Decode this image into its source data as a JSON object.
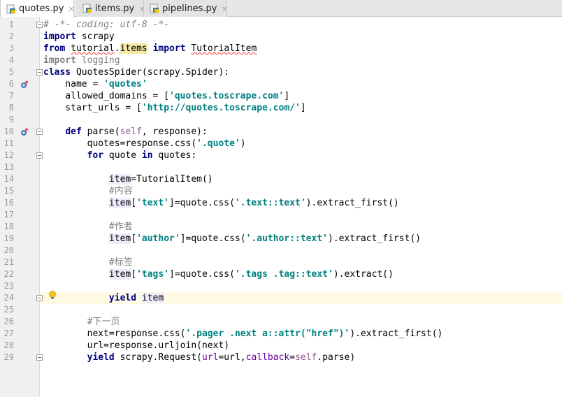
{
  "tabs": [
    {
      "label": "quotes.py",
      "active": true
    },
    {
      "label": "items.py",
      "active": false
    },
    {
      "label": "pipelines.py",
      "active": false
    }
  ],
  "close_glyph": "×",
  "lines": [
    {
      "n": "1",
      "tokens": [
        {
          "t": "# -*- coding: utf-8 -*-",
          "c": "cm"
        }
      ]
    },
    {
      "n": "2",
      "tokens": [
        {
          "t": "import",
          "c": "kw"
        },
        {
          "t": " scrapy",
          "c": ""
        }
      ]
    },
    {
      "n": "3",
      "tokens": [
        {
          "t": "from",
          "c": "kw"
        },
        {
          "t": " ",
          "c": ""
        },
        {
          "t": "tutorial",
          "c": "underline"
        },
        {
          "t": ".",
          "c": ""
        },
        {
          "t": "items",
          "c": "itemhl-yellow"
        },
        {
          "t": " ",
          "c": ""
        },
        {
          "t": "import",
          "c": "kw"
        },
        {
          "t": " ",
          "c": ""
        },
        {
          "t": "TutorialItem",
          "c": "underline"
        }
      ]
    },
    {
      "n": "4",
      "tokens": [
        {
          "t": "import",
          "c": "kw dim"
        },
        {
          "t": " logging",
          "c": "dim"
        }
      ]
    },
    {
      "n": "5",
      "tokens": [
        {
          "t": "class",
          "c": "kw"
        },
        {
          "t": " QuotesSpider(scrapy.Spider):",
          "c": ""
        }
      ]
    },
    {
      "n": "6",
      "tokens": [
        {
          "t": "    name = ",
          "c": ""
        },
        {
          "t": "'quotes'",
          "c": "str"
        }
      ]
    },
    {
      "n": "7",
      "tokens": [
        {
          "t": "    allowed_domains = [",
          "c": ""
        },
        {
          "t": "'quotes.toscrape.com'",
          "c": "str"
        },
        {
          "t": "]",
          "c": ""
        }
      ]
    },
    {
      "n": "8",
      "tokens": [
        {
          "t": "    start_urls = [",
          "c": ""
        },
        {
          "t": "'http://quotes.toscrape.com/'",
          "c": "str"
        },
        {
          "t": "]",
          "c": ""
        }
      ]
    },
    {
      "n": "9",
      "tokens": []
    },
    {
      "n": "10",
      "tokens": [
        {
          "t": "    ",
          "c": ""
        },
        {
          "t": "def",
          "c": "kw"
        },
        {
          "t": " parse(",
          "c": ""
        },
        {
          "t": "self",
          "c": "self"
        },
        {
          "t": ", response):",
          "c": ""
        }
      ]
    },
    {
      "n": "11",
      "tokens": [
        {
          "t": "        quotes=response.css(",
          "c": ""
        },
        {
          "t": "'.quote'",
          "c": "str"
        },
        {
          "t": ")",
          "c": ""
        }
      ]
    },
    {
      "n": "12",
      "tokens": [
        {
          "t": "        ",
          "c": ""
        },
        {
          "t": "for",
          "c": "kw"
        },
        {
          "t": " quote ",
          "c": ""
        },
        {
          "t": "in",
          "c": "kw"
        },
        {
          "t": " quotes:",
          "c": ""
        }
      ]
    },
    {
      "n": "13",
      "tokens": []
    },
    {
      "n": "14",
      "tokens": [
        {
          "t": "            ",
          "c": ""
        },
        {
          "t": "item",
          "c": "item-hl"
        },
        {
          "t": "=TutorialItem()",
          "c": ""
        }
      ]
    },
    {
      "n": "15",
      "tokens": [
        {
          "t": "            ",
          "c": ""
        },
        {
          "t": "#内容",
          "c": "cmz"
        }
      ]
    },
    {
      "n": "16",
      "tokens": [
        {
          "t": "            ",
          "c": ""
        },
        {
          "t": "item",
          "c": "item-hl"
        },
        {
          "t": "[",
          "c": ""
        },
        {
          "t": "'text'",
          "c": "str"
        },
        {
          "t": "]=quote.css(",
          "c": ""
        },
        {
          "t": "'.text::text'",
          "c": "str"
        },
        {
          "t": ").extract_first()",
          "c": ""
        }
      ]
    },
    {
      "n": "17",
      "tokens": []
    },
    {
      "n": "18",
      "tokens": [
        {
          "t": "            ",
          "c": ""
        },
        {
          "t": "#作者",
          "c": "cmz"
        }
      ]
    },
    {
      "n": "19",
      "tokens": [
        {
          "t": "            ",
          "c": ""
        },
        {
          "t": "item",
          "c": "item-hl"
        },
        {
          "t": "[",
          "c": ""
        },
        {
          "t": "'author'",
          "c": "str"
        },
        {
          "t": "]=quote.css(",
          "c": ""
        },
        {
          "t": "'.author::text'",
          "c": "str"
        },
        {
          "t": ").extract_first()",
          "c": ""
        }
      ]
    },
    {
      "n": "20",
      "tokens": []
    },
    {
      "n": "21",
      "tokens": [
        {
          "t": "            ",
          "c": ""
        },
        {
          "t": "#标签",
          "c": "cmz"
        }
      ]
    },
    {
      "n": "22",
      "tokens": [
        {
          "t": "            ",
          "c": ""
        },
        {
          "t": "item",
          "c": "item-hl"
        },
        {
          "t": "[",
          "c": ""
        },
        {
          "t": "'tags'",
          "c": "str"
        },
        {
          "t": "]=quote.css(",
          "c": ""
        },
        {
          "t": "'.tags .tag::text'",
          "c": "str"
        },
        {
          "t": ").extract()",
          "c": ""
        }
      ]
    },
    {
      "n": "23",
      "tokens": []
    },
    {
      "n": "24",
      "tokens": [
        {
          "t": "            ",
          "c": ""
        },
        {
          "t": "yield",
          "c": "kw"
        },
        {
          "t": " ",
          "c": ""
        },
        {
          "t": "item",
          "c": "item-hl"
        }
      ]
    },
    {
      "n": "25",
      "tokens": []
    },
    {
      "n": "26",
      "tokens": [
        {
          "t": "        ",
          "c": ""
        },
        {
          "t": "#下一页",
          "c": "cmz"
        }
      ]
    },
    {
      "n": "27",
      "tokens": [
        {
          "t": "        next=response.css(",
          "c": ""
        },
        {
          "t": "'.pager .next a::attr(\"href\")'",
          "c": "str"
        },
        {
          "t": ").extract_first()",
          "c": ""
        }
      ]
    },
    {
      "n": "28",
      "tokens": [
        {
          "t": "        url=response.urljoin(next)",
          "c": ""
        }
      ]
    },
    {
      "n": "29",
      "tokens": [
        {
          "t": "        ",
          "c": ""
        },
        {
          "t": "yield",
          "c": "kw"
        },
        {
          "t": " scrapy.Request(",
          "c": ""
        },
        {
          "t": "url",
          "c": "param"
        },
        {
          "t": "=url,",
          "c": ""
        },
        {
          "t": "callback",
          "c": "param"
        },
        {
          "t": "=",
          "c": ""
        },
        {
          "t": "self",
          "c": "self"
        },
        {
          "t": ".parse)",
          "c": ""
        }
      ]
    }
  ],
  "highlighted_line": "24",
  "colors": {
    "keyword": "#000080",
    "string": "#008080",
    "comment": "#808080",
    "self": "#94558d",
    "current_line": "#fffae3"
  }
}
